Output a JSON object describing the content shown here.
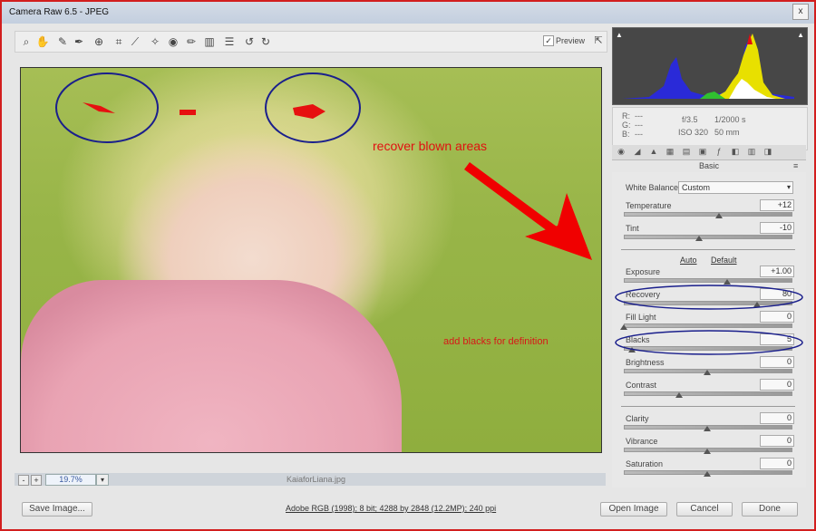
{
  "window": {
    "title": "Camera Raw 6.5  -  JPEG",
    "close": "x"
  },
  "toolbar": {
    "preview_label": "Preview",
    "preview_checked": true
  },
  "photo": {
    "annotation_recover": "recover blown areas",
    "annotation_blacks": "add blacks for definition",
    "colors": {
      "annotation_red": "#e01010",
      "circle_blue": "#1a1f8c"
    }
  },
  "zoom": {
    "minus": "-",
    "plus": "+",
    "value": "19.7%",
    "filename": "KaiaforLiana.jpg"
  },
  "readout": {
    "r": "R:",
    "g": "G:",
    "b": "B:",
    "r_val": "---",
    "g_val": "---",
    "b_val": "---",
    "aperture": "f/3.5",
    "shutter": "1/2000 s",
    "iso": "ISO 320",
    "focal": "50 mm"
  },
  "panel": {
    "section": "Basic",
    "white_balance": {
      "label": "White Balance:",
      "value": "Custom"
    },
    "auto": "Auto",
    "default": "Default",
    "controls": [
      {
        "label": "Temperature",
        "value": "+12",
        "level": 0.57
      },
      {
        "label": "Tint",
        "value": "-10",
        "level": 0.45
      },
      {
        "label": "Exposure",
        "value": "+1.00",
        "level": 0.62
      },
      {
        "label": "Recovery",
        "value": "80",
        "level": 0.8
      },
      {
        "label": "Fill Light",
        "value": "0",
        "level": 0.0
      },
      {
        "label": "Blacks",
        "value": "5",
        "level": 0.05
      },
      {
        "label": "Brightness",
        "value": "0",
        "level": 0.5
      },
      {
        "label": "Contrast",
        "value": "0",
        "level": 0.33
      },
      {
        "label": "Clarity",
        "value": "0",
        "level": 0.5
      },
      {
        "label": "Vibrance",
        "value": "0",
        "level": 0.5
      },
      {
        "label": "Saturation",
        "value": "0",
        "level": 0.5
      }
    ]
  },
  "footer": {
    "save": "Save Image...",
    "workflow": "Adobe RGB (1998); 8 bit; 4288 by 2848 (12.2MP); 240 ppi",
    "open": "Open Image",
    "cancel": "Cancel",
    "done": "Done"
  }
}
